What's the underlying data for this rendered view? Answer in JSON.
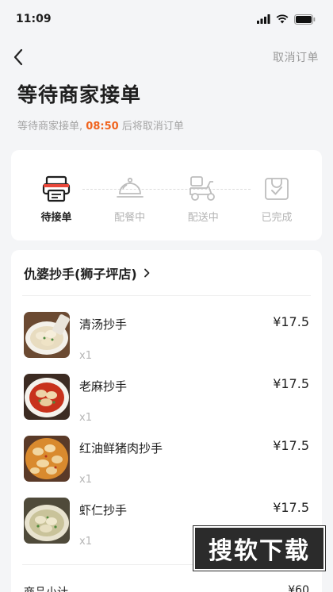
{
  "status_bar": {
    "time": "11:09",
    "icons": [
      "signal-icon",
      "wifi-icon",
      "battery-icon"
    ]
  },
  "nav": {
    "back_icon": "chevron-left-icon",
    "cancel_label": "取消订单"
  },
  "header": {
    "title": "等待商家接单",
    "subtitle_prefix": "等待商家接单,",
    "countdown": "08:50",
    "subtitle_suffix": "后将取消订单"
  },
  "steps": [
    {
      "label": "待接单",
      "icon": "printer-icon",
      "active": true
    },
    {
      "label": "配餐中",
      "icon": "food-cloche-icon",
      "active": false
    },
    {
      "label": "配送中",
      "icon": "delivery-scooter-icon",
      "active": false
    },
    {
      "label": "已完成",
      "icon": "checked-bag-icon",
      "active": false
    }
  ],
  "order": {
    "shop_name": "仇婆抄手(狮子坪店)",
    "items": [
      {
        "name": "清汤抄手",
        "qty": "x1",
        "price": "¥17.5",
        "thumb": "clear-soup-wonton-photo"
      },
      {
        "name": "老麻抄手",
        "qty": "x1",
        "price": "¥17.5",
        "thumb": "spicy-wonton-photo"
      },
      {
        "name": "红油鲜猪肉抄手",
        "qty": "x1",
        "price": "¥17.5",
        "thumb": "red-oil-pork-wonton-photo"
      },
      {
        "name": "虾仁抄手",
        "qty": "x1",
        "price": "¥17.5",
        "thumb": "shrimp-wonton-photo"
      }
    ],
    "subtotal_label": "商品小计",
    "subtotal_value": "¥60"
  },
  "watermark": {
    "text": "搜软下载"
  },
  "colors": {
    "accent": "#f0641e",
    "background": "#f4f5f7",
    "card": "#ffffff",
    "muted": "#b3b3b3"
  }
}
